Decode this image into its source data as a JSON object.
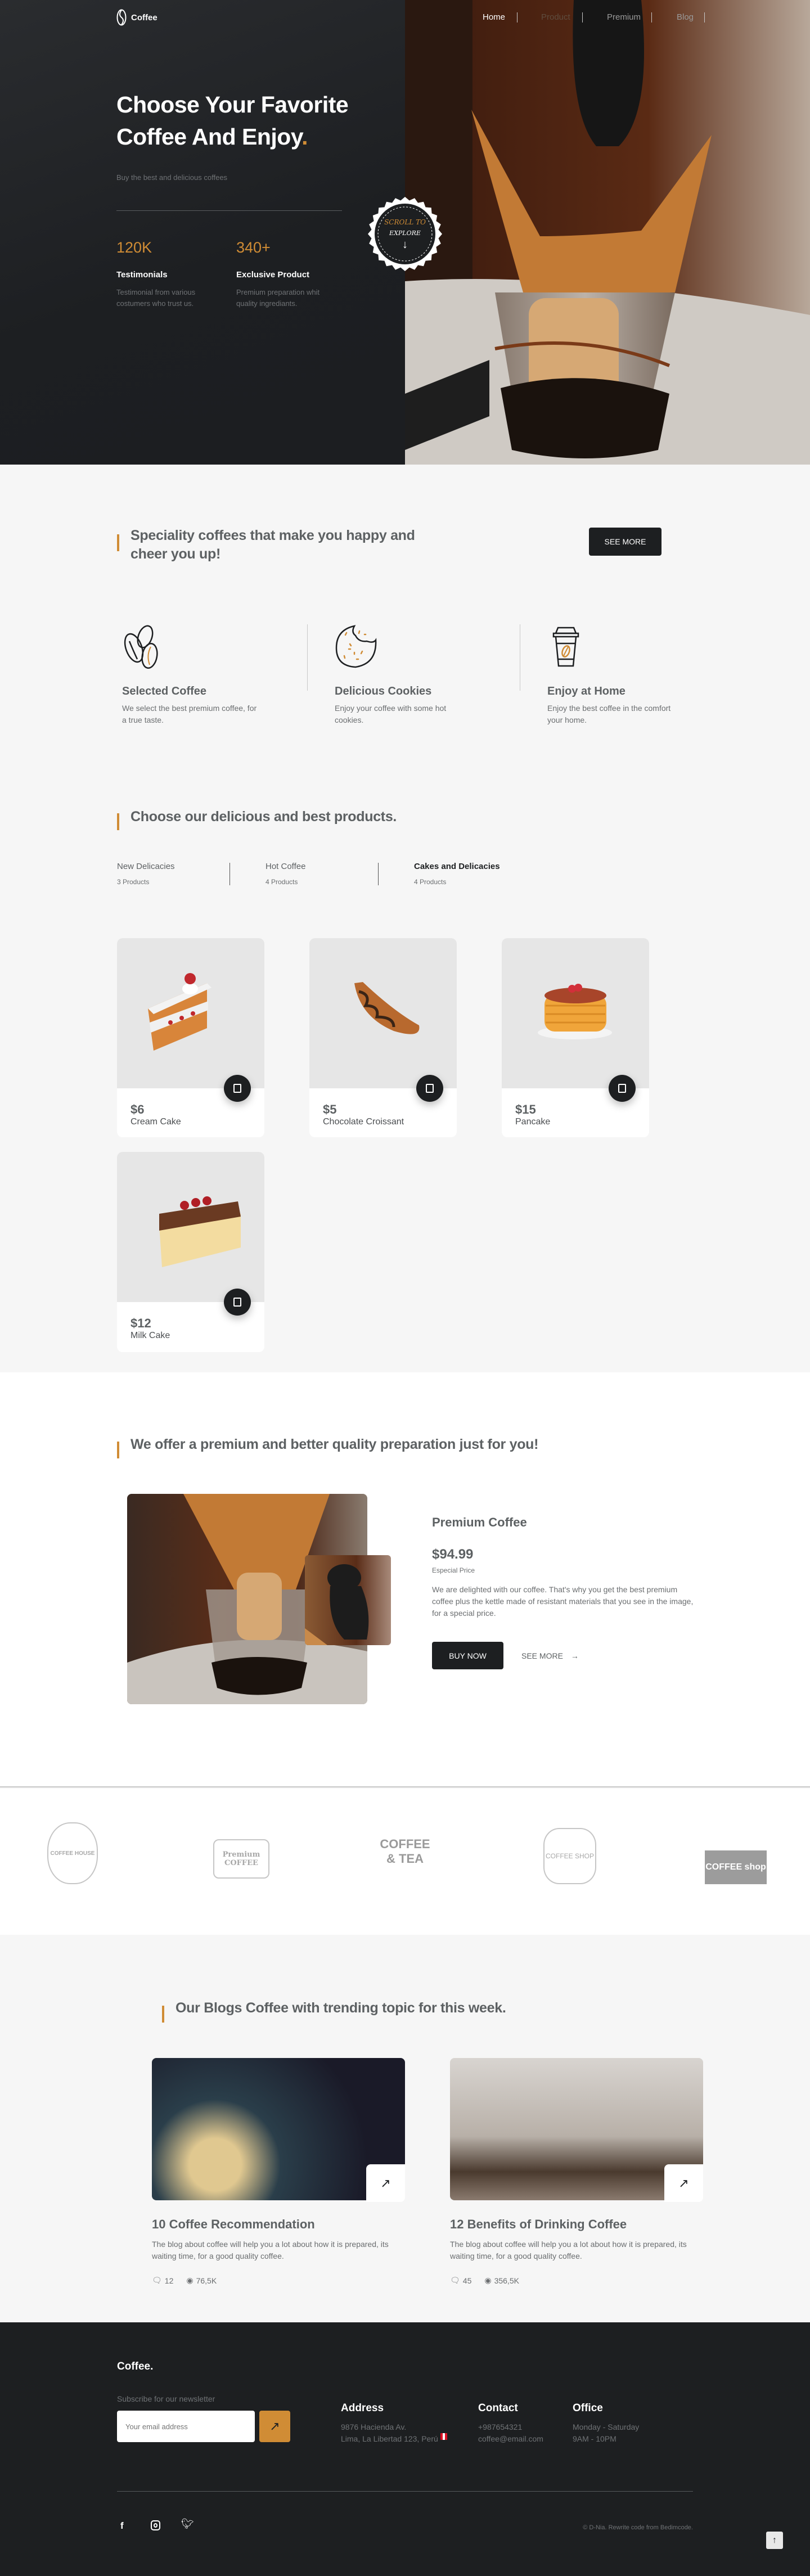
{
  "colors": {
    "accent": "#d08c35",
    "dark": "#1d1f21",
    "section_bg": "#f6f6f6",
    "heading": "#5d6163"
  },
  "nav": {
    "logo": "Coffee",
    "items": [
      {
        "label": "Home",
        "active": true
      },
      {
        "label": "Product",
        "active": false
      },
      {
        "label": "Premium",
        "active": false
      },
      {
        "label": "Blog",
        "active": false
      }
    ]
  },
  "hero": {
    "title_line1": "Choose Your Favorite",
    "title_line2": "Coffee And Enjoy",
    "title_dot": ".",
    "subtitle": "Buy the best and delicious coffees",
    "badge": {
      "line1": "SCROLL TO",
      "line2": "EXPLORE",
      "icon": "arrow-down-icon"
    },
    "stats": [
      {
        "value": "120K",
        "label": "Testimonials",
        "desc": "Testimonial from various costumers who trust us."
      },
      {
        "value": "340+",
        "label": "Exclusive Product",
        "desc": "Premium preparation whit quality ingrediants."
      }
    ]
  },
  "speciality": {
    "heading": "Speciality coffees that make you happy and cheer you up!",
    "button": "SEE MORE",
    "features": [
      {
        "icon": "coffee-beans-icon",
        "title": "Selected Coffee",
        "desc": "We select the best premium coffee, for a true taste."
      },
      {
        "icon": "cookie-icon",
        "title": "Delicious Cookies",
        "desc": "Enjoy your coffee with some hot cookies."
      },
      {
        "icon": "coffee-cup-icon",
        "title": "Enjoy at Home",
        "desc": "Enjoy the best coffee in the comfort your home."
      }
    ]
  },
  "products": {
    "heading": "Choose our delicious and best products.",
    "tabs": [
      {
        "label": "New Delicacies",
        "count": "3 Products",
        "active": false
      },
      {
        "label": "Hot Coffee",
        "count": "4 Products",
        "active": false
      },
      {
        "label": "Cakes and Delicacies",
        "count": "4 Products",
        "active": true
      }
    ],
    "items": [
      {
        "price": "$6",
        "name": "Cream Cake"
      },
      {
        "price": "$5",
        "name": "Chocolate Croissant"
      },
      {
        "price": "$15",
        "name": "Pancake"
      },
      {
        "price": "$12",
        "name": "Milk Cake"
      }
    ]
  },
  "premium": {
    "heading": "We offer a premium and better quality preparation just for you!",
    "title": "Premium Coffee",
    "price": "$94.99",
    "price_note": "Especial Price",
    "desc": "We are delighted with our coffee. That's why you get the best premium coffee plus the kettle made of resistant materials that you see in the image, for a special price.",
    "buy": "BUY NOW",
    "see_more": "SEE MORE"
  },
  "logos": [
    {
      "text": "COFFEE HOUSE"
    },
    {
      "text": "Premium COFFEE"
    },
    {
      "text": "COFFEE & TEA"
    },
    {
      "text": "COFFEE SHOP"
    },
    {
      "text": "COFFEE shop"
    }
  ],
  "blog": {
    "heading": "Our Blogs Coffee with trending topic for this week.",
    "posts": [
      {
        "title": "10 Coffee Recommendation",
        "desc": "The blog about coffee will help you a lot about how it is prepared, its waiting time, for a good quality coffee.",
        "comments": "12",
        "views": "76,5K"
      },
      {
        "title": "12 Benefits of Drinking Coffee",
        "desc": "The blog about coffee will help you a lot about how it is prepared, its waiting time, for a good quality coffee.",
        "comments": "45",
        "views": "356,5K"
      }
    ]
  },
  "footer": {
    "logo": "Coffee.",
    "newsletter_label": "Subscribe for our newsletter",
    "email_placeholder": "Your email address",
    "address": {
      "title": "Address",
      "line1": "9876 Hacienda Av.",
      "line2": "Lima, La Libertad 123, Perú"
    },
    "contact": {
      "title": "Contact",
      "phone": "+987654321",
      "email": "coffee@email.com"
    },
    "office": {
      "title": "Office",
      "days": "Monday - Saturday",
      "hours": "9AM - 10PM"
    },
    "copyright": "© D-Nia. Rewrite code from Bedimcode."
  }
}
